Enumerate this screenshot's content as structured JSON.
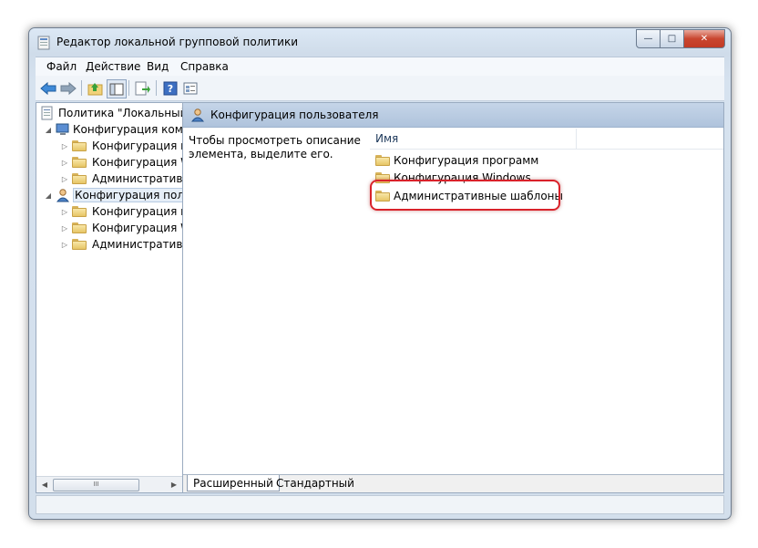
{
  "window": {
    "title": "Редактор локальной групповой политики"
  },
  "window_buttons": {
    "minimize": "—",
    "maximize": "□",
    "close": "✕"
  },
  "menu": [
    {
      "label": "Файл"
    },
    {
      "label": "Действие"
    },
    {
      "label": "Вид"
    },
    {
      "label": "Справка"
    }
  ],
  "toolbar_icons": [
    "back-arrow-icon",
    "forward-arrow-icon",
    "up-folder-icon",
    "show-hide-tree-icon",
    "export-list-icon",
    "help-icon",
    "properties-icon"
  ],
  "tree": {
    "root": "Политика \"Локальный",
    "nodes": [
      {
        "label": "Конфигурация компь",
        "level": 1,
        "expanded": true,
        "icon": "computer-icon"
      },
      {
        "label": "Конфигурация п",
        "level": 2,
        "icon": "folder-icon"
      },
      {
        "label": "Конфигурация W",
        "level": 2,
        "icon": "folder-icon"
      },
      {
        "label": "Административ",
        "level": 2,
        "icon": "folder-icon"
      },
      {
        "label": "Конфигурация поль",
        "level": 1,
        "expanded": true,
        "selected": true,
        "icon": "user-icon"
      },
      {
        "label": "Конфигурация п",
        "level": 2,
        "icon": "folder-icon"
      },
      {
        "label": "Конфигурация W",
        "level": 2,
        "icon": "folder-icon"
      },
      {
        "label": "Административ",
        "level": 2,
        "icon": "folder-icon"
      }
    ],
    "scrollbar_thumb": "III"
  },
  "right_pane": {
    "header": "Конфигурация пользователя",
    "description": "Чтобы просмотреть описание элемента, выделите его.",
    "column_name": "Имя",
    "items": [
      {
        "label": "Конфигурация программ"
      },
      {
        "label": "Конфигурация Windows"
      },
      {
        "label": "Административные шаблоны",
        "highlighted": true
      }
    ]
  },
  "tabs": [
    {
      "label": "Расширенный",
      "active": true
    },
    {
      "label": "Стандартный",
      "active": false
    }
  ],
  "colors": {
    "highlight_border": "#d9222a",
    "header_bg": "#b9cbe1"
  }
}
